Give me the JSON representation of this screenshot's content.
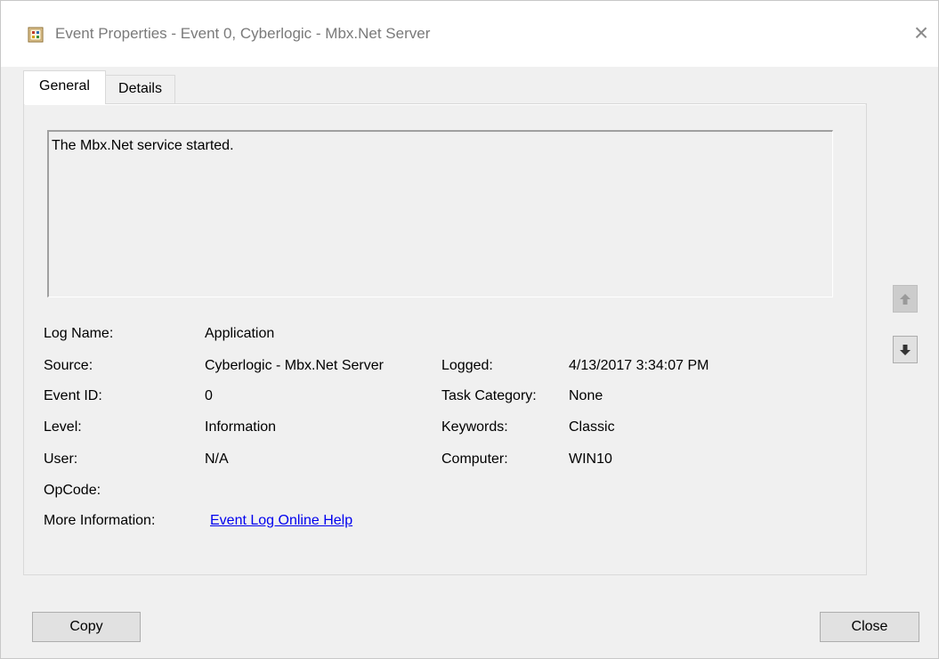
{
  "window": {
    "title": "Event Properties - Event 0, Cyberlogic - Mbx.Net Server",
    "close_glyph": "×"
  },
  "tabs": [
    {
      "label": "General",
      "active": true
    },
    {
      "label": "Details",
      "active": false
    }
  ],
  "general": {
    "description": "The Mbx.Net service started.",
    "fields": {
      "log_name": {
        "label": "Log Name:",
        "value": "Application"
      },
      "source": {
        "label": "Source:",
        "value": "Cyberlogic - Mbx.Net Server"
      },
      "logged": {
        "label": "Logged:",
        "value": "4/13/2017 3:34:07 PM"
      },
      "event_id": {
        "label": "Event ID:",
        "value": "0"
      },
      "task_category": {
        "label": "Task Category:",
        "value": "None"
      },
      "level": {
        "label": "Level:",
        "value": "Information"
      },
      "keywords": {
        "label": "Keywords:",
        "value": "Classic"
      },
      "user": {
        "label": "User:",
        "value": "N/A"
      },
      "computer": {
        "label": "Computer:",
        "value": "WIN10"
      },
      "opcode": {
        "label": "OpCode:",
        "value": ""
      },
      "more_information": {
        "label": "More Information:",
        "value": "Event Log Online Help"
      }
    }
  },
  "navigation": {
    "up_icon": "arrow-up-icon",
    "down_icon": "arrow-down-icon",
    "up_enabled": false,
    "down_enabled": true
  },
  "buttons": {
    "copy": "Copy",
    "close": "Close"
  },
  "colors": {
    "link": "#0000ee",
    "dialog_bg": "#f0f0f0",
    "title_text": "#7a7a7a"
  }
}
